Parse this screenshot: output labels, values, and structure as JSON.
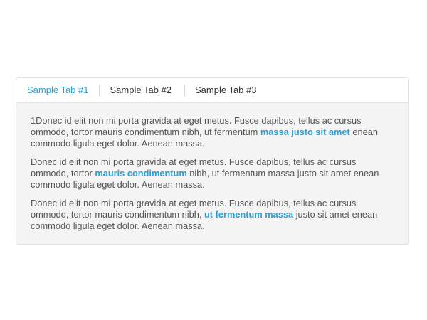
{
  "tabs": [
    {
      "label": "Sample Tab #1",
      "active": true
    },
    {
      "label": "Sample Tab #2",
      "active": false
    },
    {
      "label": "Sample Tab #3",
      "active": false
    }
  ],
  "panel": {
    "paragraphs": [
      {
        "before": "1Donec id elit non mi porta gravida at eget metus. Fusce dapibus, tellus ac cursus ommodo, tortor mauris condimentum nibh, ut fermentum ",
        "link": "massa justo sit amet",
        "after": " enean commodo ligula eget dolor. Aenean massa."
      },
      {
        "before": "Donec id elit non mi porta gravida at eget metus. Fusce dapibus, tellus ac cursus ommodo, tortor ",
        "link": "mauris condimentum",
        "after": " nibh, ut fermentum massa justo sit amet enean commodo ligula eget dolor. Aenean massa."
      },
      {
        "before": "Donec id elit non mi porta gravida at eget metus. Fusce dapibus, tellus ac cursus ommodo, tortor mauris condimentum nibh, ",
        "link": "ut fermentum massa",
        "after": " justo sit amet enean commodo ligula eget dolor. Aenean massa."
      }
    ]
  },
  "colors": {
    "accent": "#2a9fd6",
    "text": "#555555",
    "panel_bg": "#f4f4f4",
    "border": "#e1e1e1"
  }
}
